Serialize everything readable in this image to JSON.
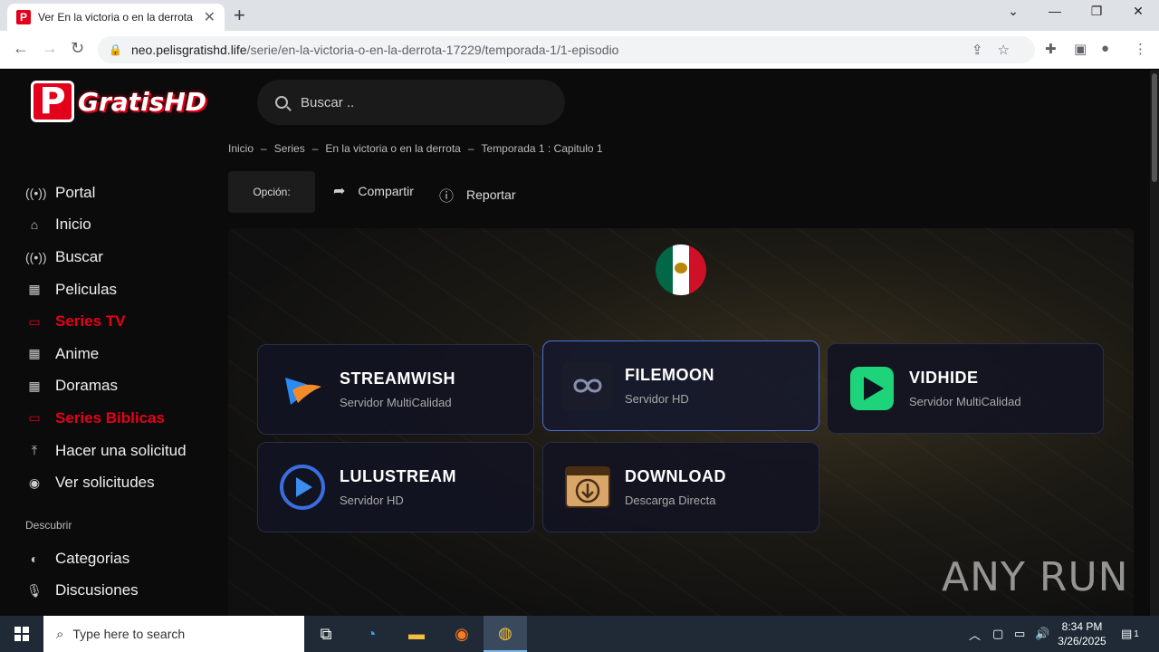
{
  "browser": {
    "tab_title": "Ver En la victoria o en la derrota",
    "tab_favicon": "P",
    "url_domain": "neo.pelisgratishd.life",
    "url_path": "/serie/en-la-victoria-o-en-la-derrota-17229/temporada-1/1-episodio"
  },
  "site": {
    "logo_letter": "P",
    "logo_text": "GratisHD",
    "search_placeholder": "Buscar .."
  },
  "sidebar": {
    "items": [
      {
        "label": "Portal",
        "icon": "radio-icon",
        "glyph": "((•))",
        "highlight": false
      },
      {
        "label": "Inicio",
        "icon": "home-icon",
        "glyph": "⌂",
        "highlight": false
      },
      {
        "label": "Buscar",
        "icon": "radio-icon",
        "glyph": "((•))",
        "highlight": false
      },
      {
        "label": "Peliculas",
        "icon": "film-icon",
        "glyph": "▦",
        "highlight": false
      },
      {
        "label": "Series TV",
        "icon": "tv-icon",
        "glyph": "▭",
        "highlight": true
      },
      {
        "label": "Anime",
        "icon": "film-icon",
        "glyph": "▦",
        "highlight": false
      },
      {
        "label": "Doramas",
        "icon": "film-icon",
        "glyph": "▦",
        "highlight": false
      },
      {
        "label": "Series Biblicas",
        "icon": "tv-icon",
        "glyph": "▭",
        "highlight": true
      },
      {
        "label": "Hacer una solicitud",
        "icon": "upload-icon",
        "glyph": "⤒",
        "highlight": false
      },
      {
        "label": "Ver solicitudes",
        "icon": "eye-icon",
        "glyph": "◉",
        "highlight": false
      }
    ],
    "discover_label": "Descubrir",
    "discover_items": [
      {
        "label": "Categorias",
        "icon": "half-circle-icon",
        "glyph": "◐"
      },
      {
        "label": "Discusiones",
        "icon": "microphone-icon",
        "glyph": "🎙"
      }
    ]
  },
  "breadcrumb": [
    "Inicio",
    "Series",
    "En la victoria o en la derrota",
    "Temporada 1 : Capitulo 1"
  ],
  "breadcrumb_sep": "–",
  "actions": {
    "opcion": "Opción:",
    "share": "Compartir",
    "report": "Reportar"
  },
  "servers": [
    {
      "name": "STREAMWISH",
      "sub": "Servidor MultiCalidad",
      "icon": "streamwish-icon",
      "active": false
    },
    {
      "name": "FILEMOON",
      "sub": "Servidor HD",
      "icon": "filemoon-icon",
      "active": true
    },
    {
      "name": "VIDHIDE",
      "sub": "Servidor MultiCalidad",
      "icon": "vidhide-icon",
      "active": false
    },
    {
      "name": "LULUSTREAM",
      "sub": "Servidor HD",
      "icon": "lulustream-icon",
      "active": false
    },
    {
      "name": "DOWNLOAD",
      "sub": "Descarga Directa",
      "icon": "download-icon",
      "active": false
    }
  ],
  "watermark": "ANY RUN",
  "taskbar": {
    "search_placeholder": "Type here to search",
    "time": "8:34 PM",
    "date": "3/26/2025",
    "notification_count": "1"
  },
  "colors": {
    "accent_red": "#e3001b",
    "active_border": "#4a6fd8",
    "taskbar": "#1f2a36"
  }
}
